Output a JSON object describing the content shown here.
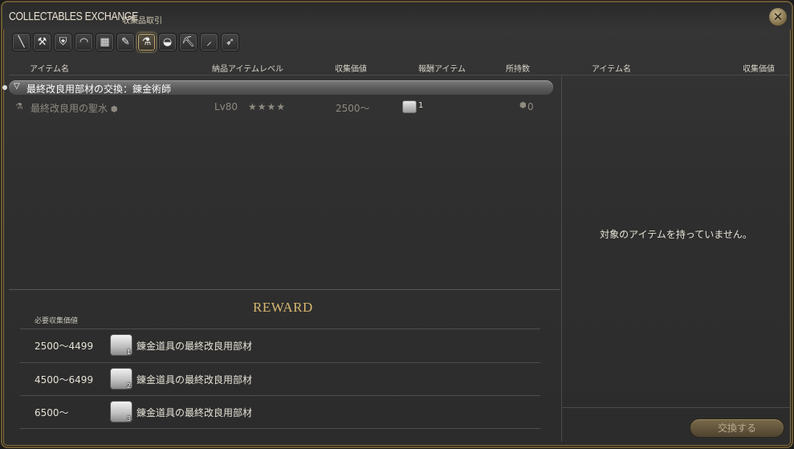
{
  "window": {
    "title_en": "COLLECTABLES EXCHANGE",
    "title_jp": "収集品取引",
    "close_icon": "close-icon"
  },
  "categories": [
    {
      "icon": "carpenter-icon",
      "glyph": "╲"
    },
    {
      "icon": "blacksmith-icon",
      "glyph": "⚒"
    },
    {
      "icon": "armorer-icon",
      "glyph": "⛨"
    },
    {
      "icon": "goldsmith-icon",
      "glyph": "◠"
    },
    {
      "icon": "leatherworker-icon",
      "glyph": "▦"
    },
    {
      "icon": "weaver-icon",
      "glyph": "✎"
    },
    {
      "icon": "alchemist-icon",
      "glyph": "⚗",
      "active": true
    },
    {
      "icon": "culinarian-icon",
      "glyph": "◒"
    },
    {
      "icon": "miner-icon",
      "glyph": "⛏"
    },
    {
      "icon": "botanist-icon",
      "glyph": "⸝"
    },
    {
      "icon": "fisher-icon",
      "glyph": "➶"
    }
  ],
  "columns": {
    "item_name": "アイテム名",
    "level": "納品アイテムレベル",
    "value": "収集価値",
    "reward": "報酬アイテム",
    "owned": "所持数",
    "right_item_name": "アイテム名",
    "right_value": "収集価値"
  },
  "group": {
    "label": "最終改良用部材の交換：錬金術師"
  },
  "item": {
    "name": "最終改良用の聖水",
    "level": "Lv80",
    "stars": "★★★★",
    "value": "2500～",
    "reward_count": "1",
    "owned": "0"
  },
  "right_panel": {
    "empty_message": "対象のアイテムを持っていません。"
  },
  "reward": {
    "title": "REWARD",
    "req_label": "必要収集価値",
    "rows": [
      {
        "range": "2500～4499",
        "count": "1",
        "name": "錬金道具の最終改良用部材"
      },
      {
        "range": "4500～6499",
        "count": "2",
        "name": "錬金道具の最終改良用部材"
      },
      {
        "range": "6500～",
        "count": "3",
        "name": "錬金道具の最終改良用部材"
      }
    ]
  },
  "buttons": {
    "exchange": "交換する"
  },
  "colors": {
    "frame_gold": "#8a7444",
    "reward_title": "#d8b870",
    "button": "#6a5a3c"
  }
}
